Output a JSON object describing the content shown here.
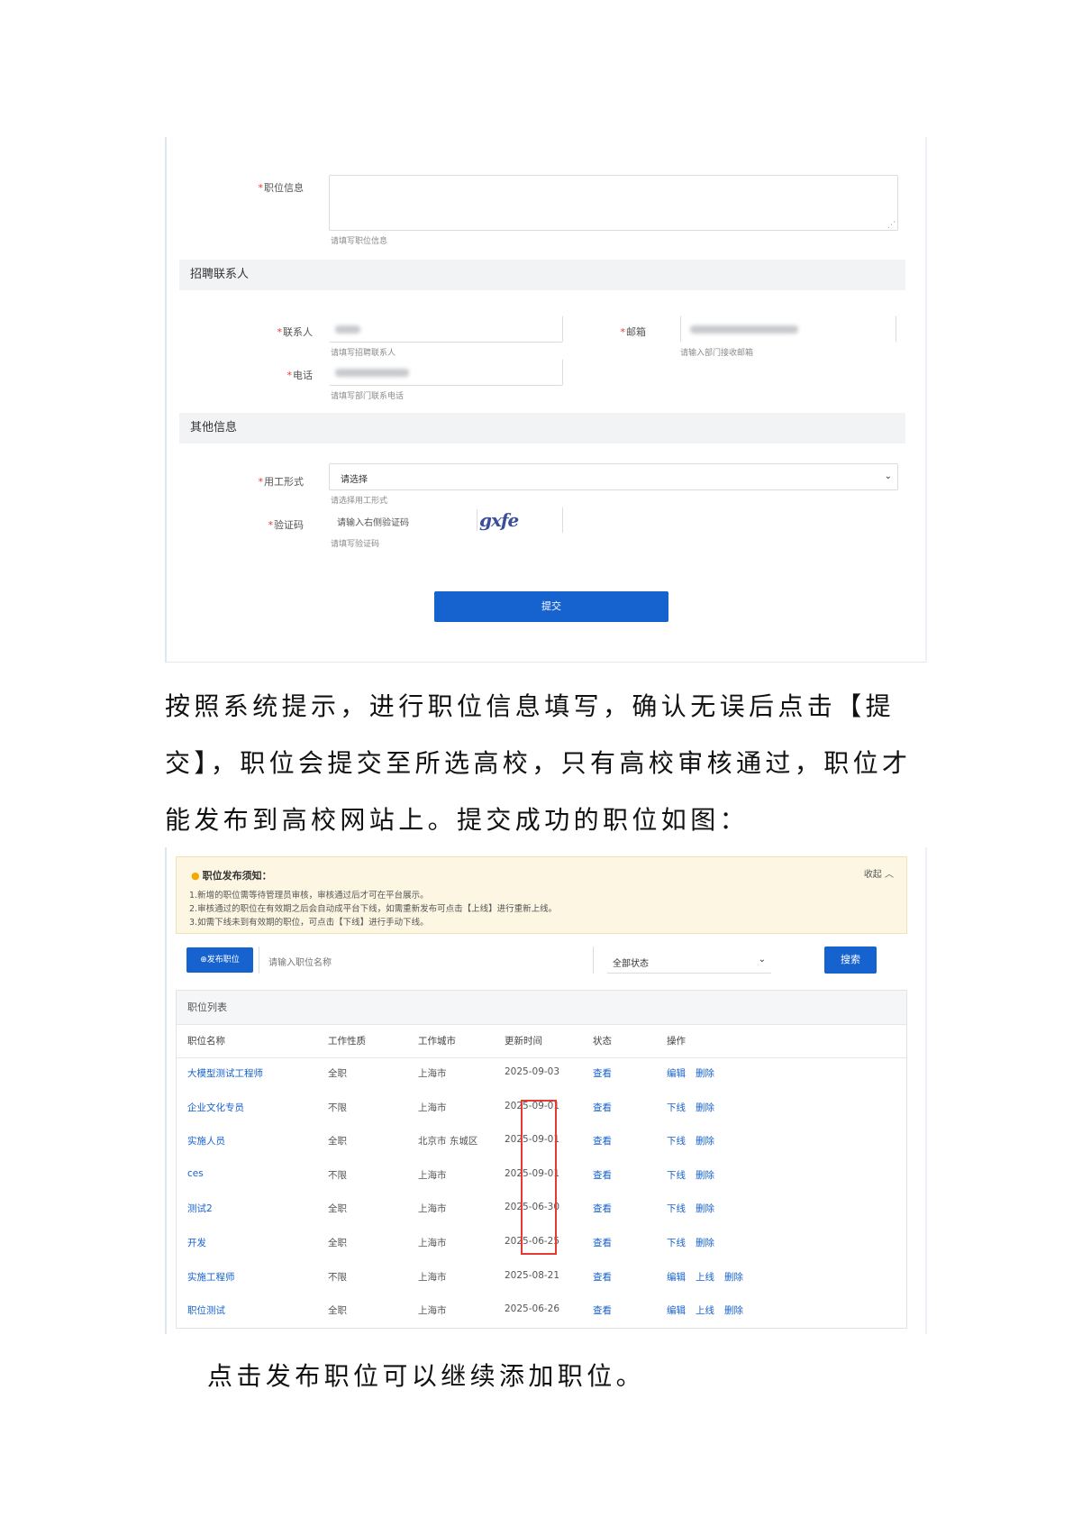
{
  "form": {
    "job_info": {
      "label": "职位信息",
      "hint": "请填写职位信息"
    },
    "section_contact": "招聘联系人",
    "contact_person": {
      "label": "联系人",
      "hint": "请填写招聘联系人"
    },
    "email": {
      "label": "邮箱",
      "hint": "请输入部门接收邮箱"
    },
    "phone": {
      "label": "电话",
      "hint": "请填写部门联系电话"
    },
    "section_other": "其他信息",
    "work_type": {
      "label": "用工形式",
      "value": "请选择",
      "hint": "请选择用工形式"
    },
    "captcha": {
      "label": "验证码",
      "placeholder": "请输入右侧验证码",
      "image_text": "gxfe",
      "hint": "请填写验证码"
    },
    "submit_label": "提交"
  },
  "paragraph1": "按照系统提示，进行职位信息填写，确认无误后点击【提交】，职位会提交至所选高校，只有高校审核通过，职位才能发布到高校网站上。提交成功的职位如图：",
  "list": {
    "notice": {
      "title": "职位发布须知：",
      "collapse": "收起",
      "lines": [
        "1.新增的职位需等待管理员审核，审核通过后才可在平台展示。",
        "2.审核通过的职位在有效期之后会自动成平台下线，如需重新发布可点击【上线】进行重新上线。",
        "3.如需下线未到有效期的职位，可点击【下线】进行手动下线。"
      ]
    },
    "publish_label": "发布职位",
    "search_placeholder": "请输入职位名称",
    "status_select": "全部状态",
    "search_label": "搜索",
    "table_title": "职位列表",
    "columns": [
      "职位名称",
      "工作性质",
      "工作城市",
      "更新时间",
      "状态",
      "操作"
    ],
    "rows": [
      {
        "name": "大模型测试工程师",
        "type": "全职",
        "city": "上海市",
        "date": "2025-09-03",
        "status": "查看",
        "actions": [
          "编辑",
          "删除"
        ]
      },
      {
        "name": "企业文化专员",
        "type": "不限",
        "city": "上海市",
        "date": "2025-09-01",
        "status": "查看",
        "actions": [
          "下线",
          "删除"
        ]
      },
      {
        "name": "实施人员",
        "type": "全职",
        "city": "北京市  东城区",
        "date": "2025-09-01",
        "status": "查看",
        "actions": [
          "下线",
          "删除"
        ]
      },
      {
        "name": "ces",
        "type": "不限",
        "city": "上海市",
        "date": "2025-09-01",
        "status": "查看",
        "actions": [
          "下线",
          "删除"
        ]
      },
      {
        "name": "测试2",
        "type": "全职",
        "city": "上海市",
        "date": "2025-06-30",
        "status": "查看",
        "actions": [
          "下线",
          "删除"
        ]
      },
      {
        "name": "开发",
        "type": "全职",
        "city": "上海市",
        "date": "2025-06-25",
        "status": "查看",
        "actions": [
          "下线",
          "删除"
        ]
      },
      {
        "name": "实施工程师",
        "type": "不限",
        "city": "上海市",
        "date": "2025-08-21",
        "status": "查看",
        "actions": [
          "编辑",
          "上线",
          "删除"
        ]
      },
      {
        "name": "职位测试",
        "type": "全职",
        "city": "上海市",
        "date": "2025-06-26",
        "status": "查看",
        "actions": [
          "编辑",
          "上线",
          "删除"
        ]
      }
    ]
  },
  "paragraph2": "点击发布职位可以继续添加职位。"
}
